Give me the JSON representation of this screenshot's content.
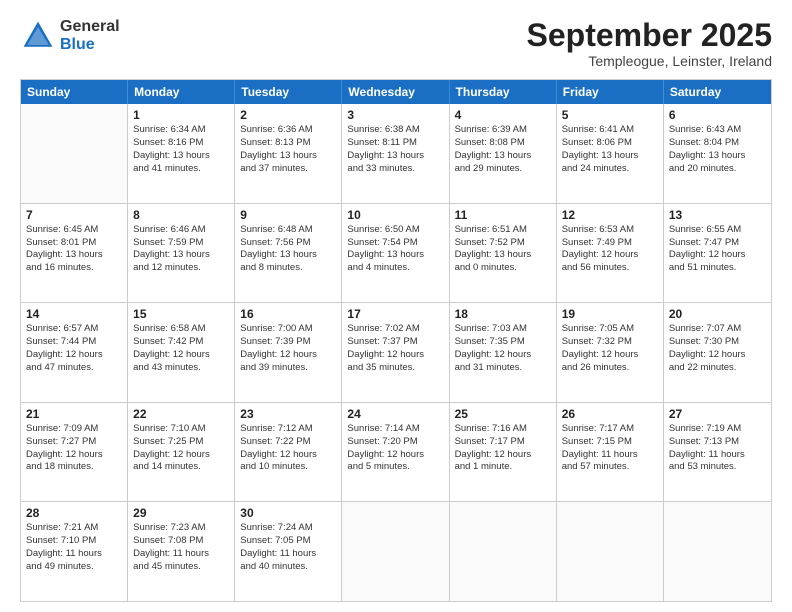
{
  "logo": {
    "general": "General",
    "blue": "Blue"
  },
  "title": "September 2025",
  "location": "Templeogue, Leinster, Ireland",
  "days_of_week": [
    "Sunday",
    "Monday",
    "Tuesday",
    "Wednesday",
    "Thursday",
    "Friday",
    "Saturday"
  ],
  "weeks": [
    [
      {
        "day": "",
        "info": ""
      },
      {
        "day": "1",
        "info": "Sunrise: 6:34 AM\nSunset: 8:16 PM\nDaylight: 13 hours\nand 41 minutes."
      },
      {
        "day": "2",
        "info": "Sunrise: 6:36 AM\nSunset: 8:13 PM\nDaylight: 13 hours\nand 37 minutes."
      },
      {
        "day": "3",
        "info": "Sunrise: 6:38 AM\nSunset: 8:11 PM\nDaylight: 13 hours\nand 33 minutes."
      },
      {
        "day": "4",
        "info": "Sunrise: 6:39 AM\nSunset: 8:08 PM\nDaylight: 13 hours\nand 29 minutes."
      },
      {
        "day": "5",
        "info": "Sunrise: 6:41 AM\nSunset: 8:06 PM\nDaylight: 13 hours\nand 24 minutes."
      },
      {
        "day": "6",
        "info": "Sunrise: 6:43 AM\nSunset: 8:04 PM\nDaylight: 13 hours\nand 20 minutes."
      }
    ],
    [
      {
        "day": "7",
        "info": "Sunrise: 6:45 AM\nSunset: 8:01 PM\nDaylight: 13 hours\nand 16 minutes."
      },
      {
        "day": "8",
        "info": "Sunrise: 6:46 AM\nSunset: 7:59 PM\nDaylight: 13 hours\nand 12 minutes."
      },
      {
        "day": "9",
        "info": "Sunrise: 6:48 AM\nSunset: 7:56 PM\nDaylight: 13 hours\nand 8 minutes."
      },
      {
        "day": "10",
        "info": "Sunrise: 6:50 AM\nSunset: 7:54 PM\nDaylight: 13 hours\nand 4 minutes."
      },
      {
        "day": "11",
        "info": "Sunrise: 6:51 AM\nSunset: 7:52 PM\nDaylight: 13 hours\nand 0 minutes."
      },
      {
        "day": "12",
        "info": "Sunrise: 6:53 AM\nSunset: 7:49 PM\nDaylight: 12 hours\nand 56 minutes."
      },
      {
        "day": "13",
        "info": "Sunrise: 6:55 AM\nSunset: 7:47 PM\nDaylight: 12 hours\nand 51 minutes."
      }
    ],
    [
      {
        "day": "14",
        "info": "Sunrise: 6:57 AM\nSunset: 7:44 PM\nDaylight: 12 hours\nand 47 minutes."
      },
      {
        "day": "15",
        "info": "Sunrise: 6:58 AM\nSunset: 7:42 PM\nDaylight: 12 hours\nand 43 minutes."
      },
      {
        "day": "16",
        "info": "Sunrise: 7:00 AM\nSunset: 7:39 PM\nDaylight: 12 hours\nand 39 minutes."
      },
      {
        "day": "17",
        "info": "Sunrise: 7:02 AM\nSunset: 7:37 PM\nDaylight: 12 hours\nand 35 minutes."
      },
      {
        "day": "18",
        "info": "Sunrise: 7:03 AM\nSunset: 7:35 PM\nDaylight: 12 hours\nand 31 minutes."
      },
      {
        "day": "19",
        "info": "Sunrise: 7:05 AM\nSunset: 7:32 PM\nDaylight: 12 hours\nand 26 minutes."
      },
      {
        "day": "20",
        "info": "Sunrise: 7:07 AM\nSunset: 7:30 PM\nDaylight: 12 hours\nand 22 minutes."
      }
    ],
    [
      {
        "day": "21",
        "info": "Sunrise: 7:09 AM\nSunset: 7:27 PM\nDaylight: 12 hours\nand 18 minutes."
      },
      {
        "day": "22",
        "info": "Sunrise: 7:10 AM\nSunset: 7:25 PM\nDaylight: 12 hours\nand 14 minutes."
      },
      {
        "day": "23",
        "info": "Sunrise: 7:12 AM\nSunset: 7:22 PM\nDaylight: 12 hours\nand 10 minutes."
      },
      {
        "day": "24",
        "info": "Sunrise: 7:14 AM\nSunset: 7:20 PM\nDaylight: 12 hours\nand 5 minutes."
      },
      {
        "day": "25",
        "info": "Sunrise: 7:16 AM\nSunset: 7:17 PM\nDaylight: 12 hours\nand 1 minute."
      },
      {
        "day": "26",
        "info": "Sunrise: 7:17 AM\nSunset: 7:15 PM\nDaylight: 11 hours\nand 57 minutes."
      },
      {
        "day": "27",
        "info": "Sunrise: 7:19 AM\nSunset: 7:13 PM\nDaylight: 11 hours\nand 53 minutes."
      }
    ],
    [
      {
        "day": "28",
        "info": "Sunrise: 7:21 AM\nSunset: 7:10 PM\nDaylight: 11 hours\nand 49 minutes."
      },
      {
        "day": "29",
        "info": "Sunrise: 7:23 AM\nSunset: 7:08 PM\nDaylight: 11 hours\nand 45 minutes."
      },
      {
        "day": "30",
        "info": "Sunrise: 7:24 AM\nSunset: 7:05 PM\nDaylight: 11 hours\nand 40 minutes."
      },
      {
        "day": "",
        "info": ""
      },
      {
        "day": "",
        "info": ""
      },
      {
        "day": "",
        "info": ""
      },
      {
        "day": "",
        "info": ""
      }
    ]
  ]
}
